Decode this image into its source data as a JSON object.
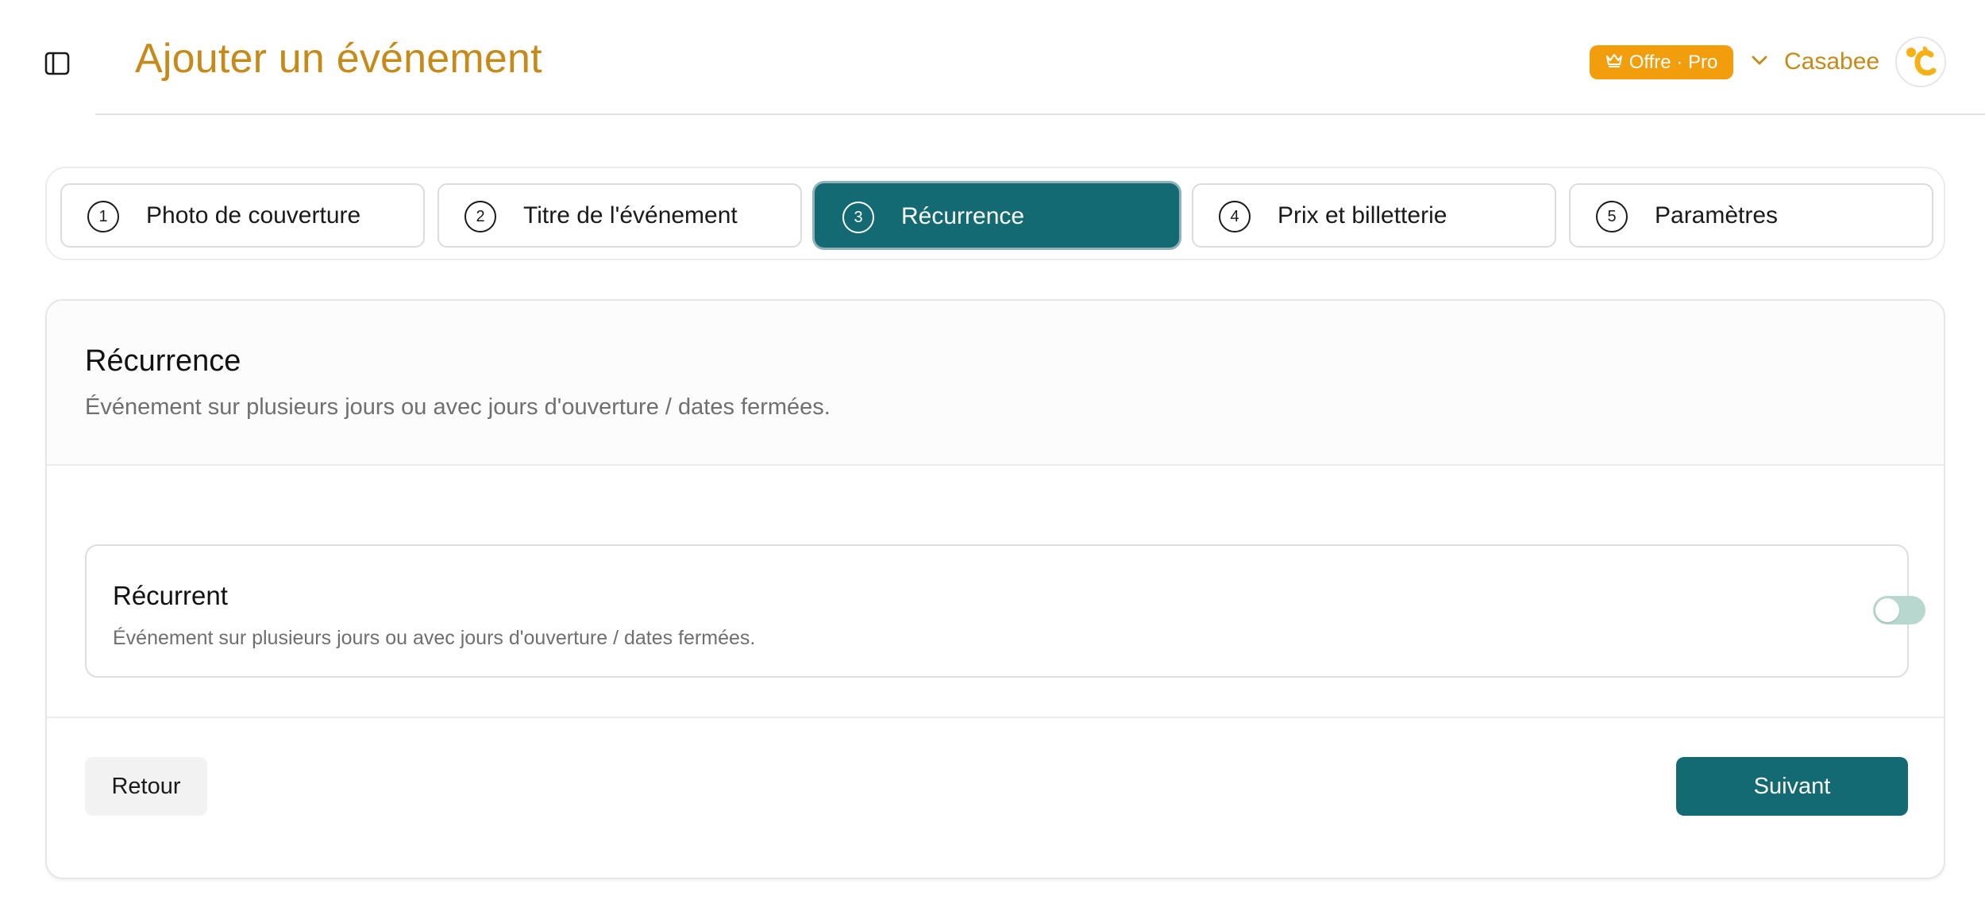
{
  "header": {
    "title": "Ajouter un événement",
    "offer_badge": "Offre · Pro",
    "account_name": "Casabee",
    "icons": {
      "sidebar_toggle": "sidebar-panel-icon",
      "badge": "crown-icon",
      "account_chevron": "chevron-down-icon",
      "avatar": "casabee-logo"
    }
  },
  "stepper": {
    "steps": [
      {
        "number": "1",
        "label": "Photo de couverture",
        "active": false
      },
      {
        "number": "2",
        "label": "Titre de l'événement",
        "active": false
      },
      {
        "number": "3",
        "label": "Récurrence",
        "active": true
      },
      {
        "number": "4",
        "label": "Prix et billetterie",
        "active": false
      },
      {
        "number": "5",
        "label": "Paramètres",
        "active": false
      }
    ]
  },
  "section": {
    "title": "Récurrence",
    "subtitle": "Événement sur plusieurs jours ou avec jours d'ouverture / dates fermées.",
    "option": {
      "title": "Récurrent",
      "description": "Événement sur plusieurs jours ou avec jours d'ouverture / dates fermées.",
      "enabled": false
    }
  },
  "actions": {
    "back_label": "Retour",
    "next_label": "Suivant"
  },
  "colors": {
    "accent_gold": "#c58a19",
    "badge_orange": "#f29d0c",
    "primary_teal": "#136a72",
    "toggle_off": "#b8d7cf"
  }
}
